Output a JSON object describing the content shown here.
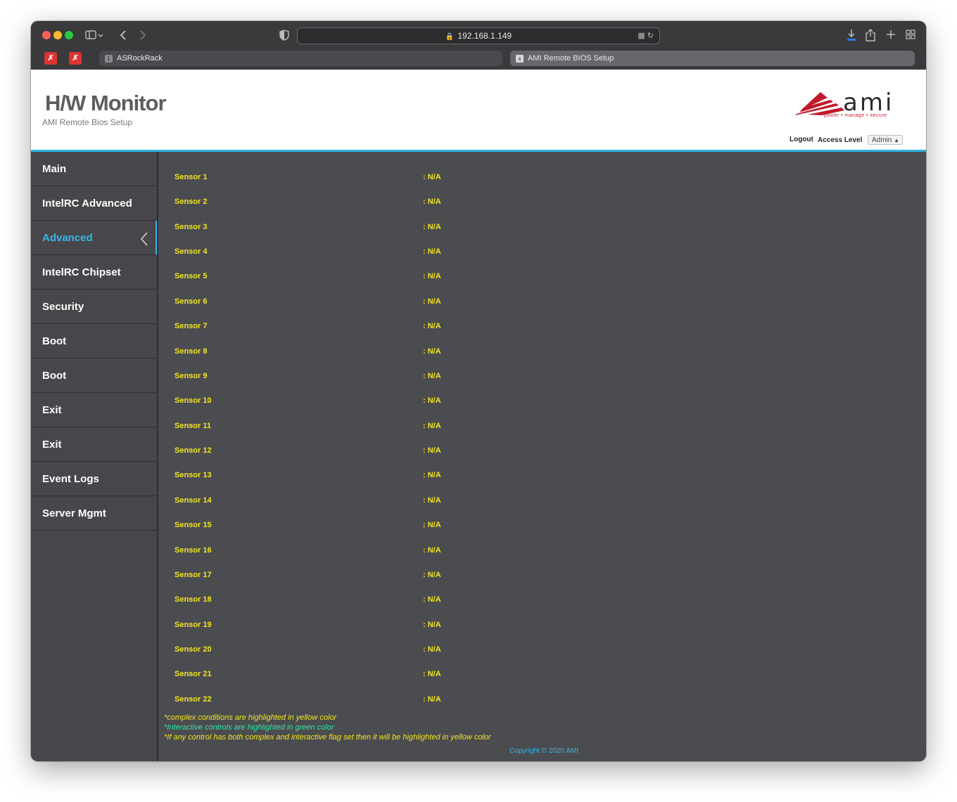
{
  "browser": {
    "url": "192.168.1.149",
    "tabs": [
      {
        "badge": "1",
        "label": "ASRockRack"
      },
      {
        "badge": "x",
        "label": "AMI Remote BIOS Setup"
      }
    ]
  },
  "header": {
    "title": "H/W Monitor",
    "subtitle": "AMI Remote Bios Setup",
    "logo_text": "ami",
    "logo_tagline": "power • manage • secure",
    "logout_label": "Logout",
    "access_level_label": "Access Level",
    "access_level_value": "Admin"
  },
  "sidebar": {
    "items": [
      {
        "label": "Main"
      },
      {
        "label": "IntelRC Advanced"
      },
      {
        "label": "Advanced",
        "active": true
      },
      {
        "label": "IntelRC Chipset"
      },
      {
        "label": "Security"
      },
      {
        "label": "Boot"
      },
      {
        "label": "Boot"
      },
      {
        "label": "Exit"
      },
      {
        "label": "Exit"
      },
      {
        "label": "Event Logs"
      },
      {
        "label": "Server Mgmt"
      }
    ]
  },
  "sensors": [
    {
      "label": "Sensor 1",
      "value": ": N/A"
    },
    {
      "label": "Sensor 2",
      "value": ": N/A"
    },
    {
      "label": "Sensor 3",
      "value": ": N/A"
    },
    {
      "label": "Sensor 4",
      "value": ": N/A"
    },
    {
      "label": "Sensor 5",
      "value": ": N/A"
    },
    {
      "label": "Sensor 6",
      "value": ": N/A"
    },
    {
      "label": "Sensor 7",
      "value": ": N/A"
    },
    {
      "label": "Sensor 8",
      "value": ": N/A"
    },
    {
      "label": "Sensor 9",
      "value": ": N/A"
    },
    {
      "label": "Sensor 10",
      "value": ": N/A"
    },
    {
      "label": "Sensor 11",
      "value": ": N/A"
    },
    {
      "label": "Sensor 12",
      "value": ": N/A"
    },
    {
      "label": "Sensor 13",
      "value": ": N/A"
    },
    {
      "label": "Sensor 14",
      "value": ": N/A"
    },
    {
      "label": "Sensor 15",
      "value": ": N/A"
    },
    {
      "label": "Sensor 16",
      "value": ": N/A"
    },
    {
      "label": "Sensor 17",
      "value": ": N/A"
    },
    {
      "label": "Sensor 18",
      "value": ": N/A"
    },
    {
      "label": "Sensor 19",
      "value": ": N/A"
    },
    {
      "label": "Sensor 20",
      "value": ": N/A"
    },
    {
      "label": "Sensor 21",
      "value": ": N/A"
    },
    {
      "label": "Sensor 22",
      "value": ": N/A"
    }
  ],
  "notes": {
    "complex": "*complex conditions are highlighted in yellow color",
    "interactive": "*Interactive controls are highlighted in green color",
    "both": "*If any control has both complex and interactive flag set then it will be highlighted in yellow color"
  },
  "footer": {
    "copyright": "Copyright © 2020 AMI"
  },
  "colors": {
    "accent": "#35b7e6",
    "sensor_text": "#f2e51c",
    "interactive_note": "#2ee8a0",
    "panel_bg": "#4b4c50"
  }
}
